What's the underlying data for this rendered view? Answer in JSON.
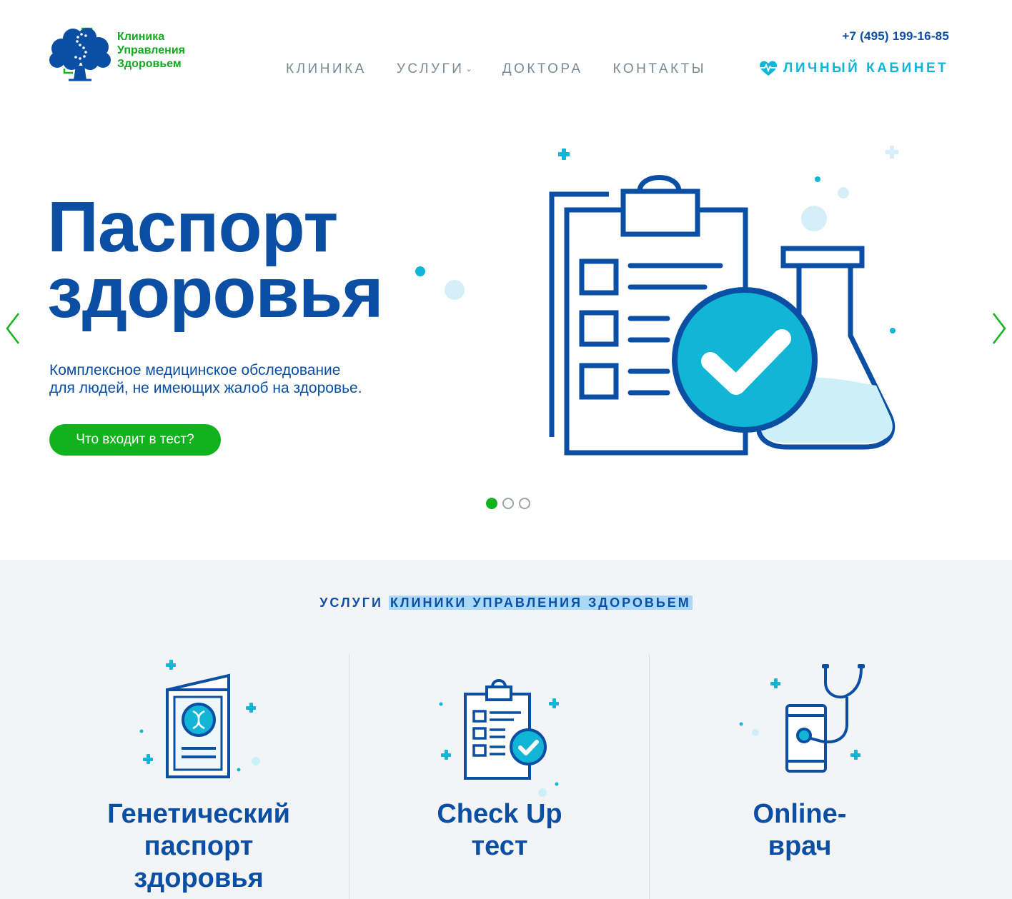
{
  "brand": {
    "line1": "Клиника",
    "line2": "Управления",
    "line3": "Здоровьем"
  },
  "header": {
    "phone": "+7 (495) 199-16-85",
    "nav": [
      {
        "label": "КЛИНИКА"
      },
      {
        "label": "УСЛУГИ",
        "has_dropdown": true
      },
      {
        "label": "ДОКТОРА"
      },
      {
        "label": "КОНТАКТЫ"
      }
    ],
    "cabinet_label": "ЛИЧНЫЙ КАБИНЕТ",
    "cabinet_icon": "heart-pulse-icon"
  },
  "hero": {
    "title_line1": "Паспорт",
    "title_line2": "здоровья",
    "subtitle_line1": "Комплексное медицинское обследование",
    "subtitle_line2": "для людей, не имеющих жалоб на здоровье.",
    "cta_label": "Что входит в тест?",
    "slides_total": 3,
    "slide_active": 1
  },
  "services": {
    "heading_part1": "УСЛУГИ",
    "heading_part2": "КЛИНИКИ УПРАВЛЕНИЯ ЗДОРОВЬЕМ",
    "cards": [
      {
        "line1": "Генетический",
        "line2": "паспорт",
        "line3": "здоровья",
        "icon": "genetic-passport-icon"
      },
      {
        "line1": "Check Up",
        "line2": "тест",
        "icon": "checkup-clipboard-icon"
      },
      {
        "line1": "Online-",
        "line2": "врач",
        "icon": "phone-stethoscope-icon"
      }
    ]
  },
  "colors": {
    "brand_blue": "#0a4fa3",
    "brand_green": "#12b21f",
    "accent_cyan": "#11b5d6",
    "nav_gray": "#7a8a96",
    "section_bg": "#f3f4f5"
  }
}
